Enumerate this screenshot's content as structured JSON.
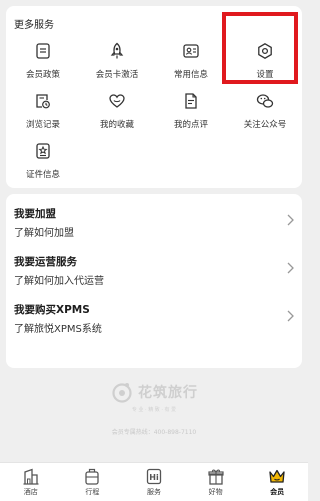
{
  "services": {
    "title": "更多服务",
    "items": [
      {
        "label": "会员政策",
        "icon": "membership-policy-icon"
      },
      {
        "label": "会员卡激活",
        "icon": "rocket-icon"
      },
      {
        "label": "常用信息",
        "icon": "id-card-icon"
      },
      {
        "label": "设置",
        "icon": "gear-icon"
      },
      {
        "label": "浏览记录",
        "icon": "history-icon"
      },
      {
        "label": "我的收藏",
        "icon": "heart-icon"
      },
      {
        "label": "我的点评",
        "icon": "review-icon"
      },
      {
        "label": "关注公众号",
        "icon": "wechat-icon"
      },
      {
        "label": "证件信息",
        "icon": "certificate-icon"
      }
    ]
  },
  "join": {
    "rows": [
      {
        "title": "我要加盟",
        "subtitle": "了解如何加盟"
      },
      {
        "title": "我要运营服务",
        "subtitle": "了解如何加入代运营"
      },
      {
        "title": "我要购买XPMS",
        "subtitle": "了解旅悦XPMS系统"
      }
    ]
  },
  "brand": {
    "name": "花筑旅行",
    "tagline": "专 业 · 精 致 · 有 爱",
    "hotline": "会员专属热线：400-898-7110"
  },
  "tabbar": {
    "tabs": [
      {
        "label": "酒店",
        "icon": "hotel-icon"
      },
      {
        "label": "行程",
        "icon": "luggage-icon"
      },
      {
        "label": "服务",
        "icon": "service-icon"
      },
      {
        "label": "好物",
        "icon": "gift-icon"
      },
      {
        "label": "会员",
        "icon": "crown-icon",
        "active": true
      }
    ]
  },
  "colors": {
    "highlight": "#e0191e",
    "accent": "#f2b705"
  }
}
